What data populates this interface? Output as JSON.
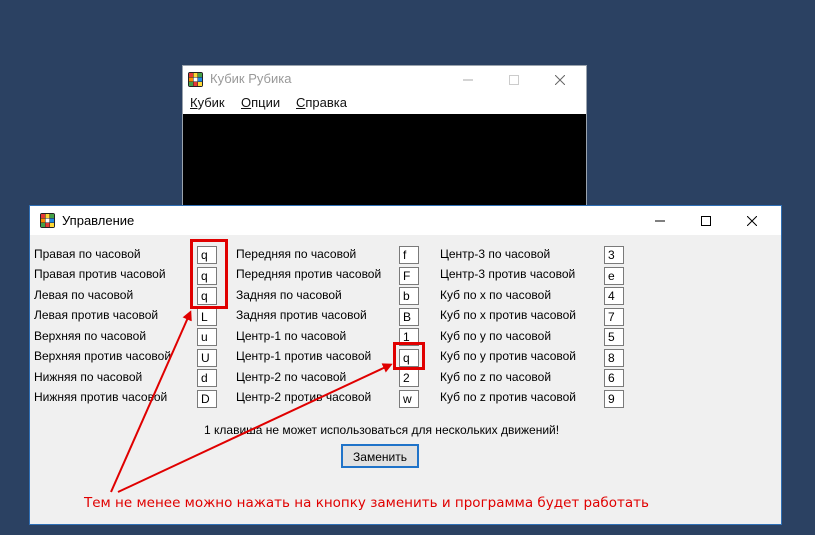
{
  "bg_window": {
    "title": "Кубик Рубика",
    "menu": [
      "Кубик",
      "Опции",
      "Справка"
    ]
  },
  "dialog": {
    "title": "Управление",
    "columns": [
      {
        "rows": [
          {
            "label": "Правая по часовой",
            "key": "q"
          },
          {
            "label": "Правая против часовой",
            "key": "q"
          },
          {
            "label": "Левая по часовой",
            "key": "q"
          },
          {
            "label": "Левая против часовой",
            "key": "L"
          },
          {
            "label": "Верхняя по часовой",
            "key": "u"
          },
          {
            "label": "Верхняя против часовой",
            "key": "U"
          },
          {
            "label": "Нижняя по часовой",
            "key": "d"
          },
          {
            "label": "Нижняя против часовой",
            "key": "D"
          }
        ]
      },
      {
        "rows": [
          {
            "label": "Передняя по часовой",
            "key": "f"
          },
          {
            "label": "Передняя против часовой",
            "key": "F"
          },
          {
            "label": "Задняя по часовой",
            "key": "b"
          },
          {
            "label": "Задняя против часовой",
            "key": "B"
          },
          {
            "label": "Центр-1 по часовой",
            "key": "1"
          },
          {
            "label": "Центр-1 против часовой",
            "key": "q"
          },
          {
            "label": "Центр-2 по часовой",
            "key": "2"
          },
          {
            "label": "Центр-2 против часовой",
            "key": "w"
          }
        ]
      },
      {
        "rows": [
          {
            "label": "Центр-3 по часовой",
            "key": "3"
          },
          {
            "label": "Центр-3 против часовой",
            "key": "e"
          },
          {
            "label": "Куб по x по часовой",
            "key": "4"
          },
          {
            "label": "Куб по x против часовой",
            "key": "7"
          },
          {
            "label": "Куб по y по часовой",
            "key": "5"
          },
          {
            "label": "Куб по y против часовой",
            "key": "8"
          },
          {
            "label": "Куб по z по часовой",
            "key": "6"
          },
          {
            "label": "Куб по z против часовой",
            "key": "9"
          }
        ]
      }
    ],
    "warning": "1 клавиша не может использоваться для нескольких движений!",
    "replace_button": "Заменить"
  },
  "annotation": {
    "text": "Тем не менее можно нажать на кнопку заменить и программа будет работать",
    "color": "#e00000"
  },
  "colors": {
    "desktop": "#2b4162",
    "highlight": "#e00000",
    "button_border": "#1f73c9"
  },
  "icons": [
    "rubiks-cube-icon",
    "minimize-icon",
    "maximize-icon",
    "close-icon"
  ]
}
